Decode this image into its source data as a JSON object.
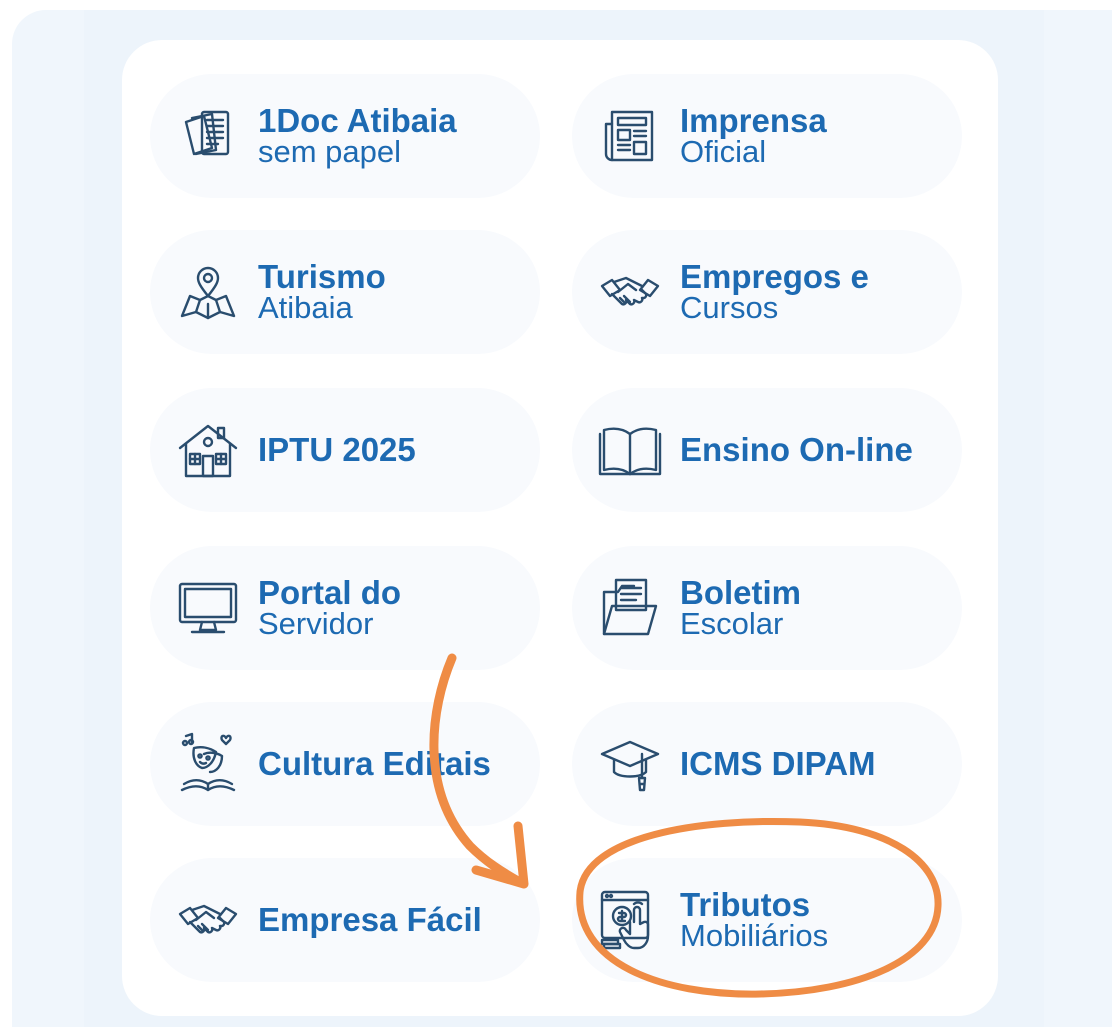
{
  "colors": {
    "text": "#1d6ab2",
    "icon_stroke": "#2a4d6e",
    "card_bg": "#ffffff",
    "tile_bg": "#f8fafd",
    "page_bg": "#f0f6fc",
    "annotation": "#ef8c45"
  },
  "tiles": [
    {
      "line1": "1Doc Atibaia",
      "line2": "sem papel",
      "icon": "documents-icon"
    },
    {
      "line1": "Imprensa",
      "line2": "Oficial",
      "icon": "newspaper-icon"
    },
    {
      "line1": "Turismo",
      "line2": "Atibaia",
      "icon": "map-pin-icon"
    },
    {
      "line1": "Empregos e",
      "line2": "Cursos",
      "icon": "handshake-icon"
    },
    {
      "line1": "IPTU 2025",
      "line2": "",
      "icon": "house-icon"
    },
    {
      "line1": "Ensino On-line",
      "line2": "",
      "icon": "open-book-icon"
    },
    {
      "line1": "Portal do",
      "line2": "Servidor",
      "icon": "monitor-icon"
    },
    {
      "line1": "Boletim",
      "line2": "Escolar",
      "icon": "folder-icon"
    },
    {
      "line1": "Cultura Editais",
      "line2": "",
      "icon": "theater-masks-icon"
    },
    {
      "line1": "ICMS DIPAM",
      "line2": "",
      "icon": "graduation-cap-icon"
    },
    {
      "line1": "Empresa Fácil",
      "line2": "",
      "icon": "handshake-icon"
    },
    {
      "line1": "Tributos",
      "line2": "Mobiliários",
      "icon": "tax-tap-icon"
    }
  ],
  "annotation": {
    "highlighted_tile": "Tributos Mobiliários",
    "shapes": [
      "curved-arrow",
      "ellipse"
    ]
  }
}
